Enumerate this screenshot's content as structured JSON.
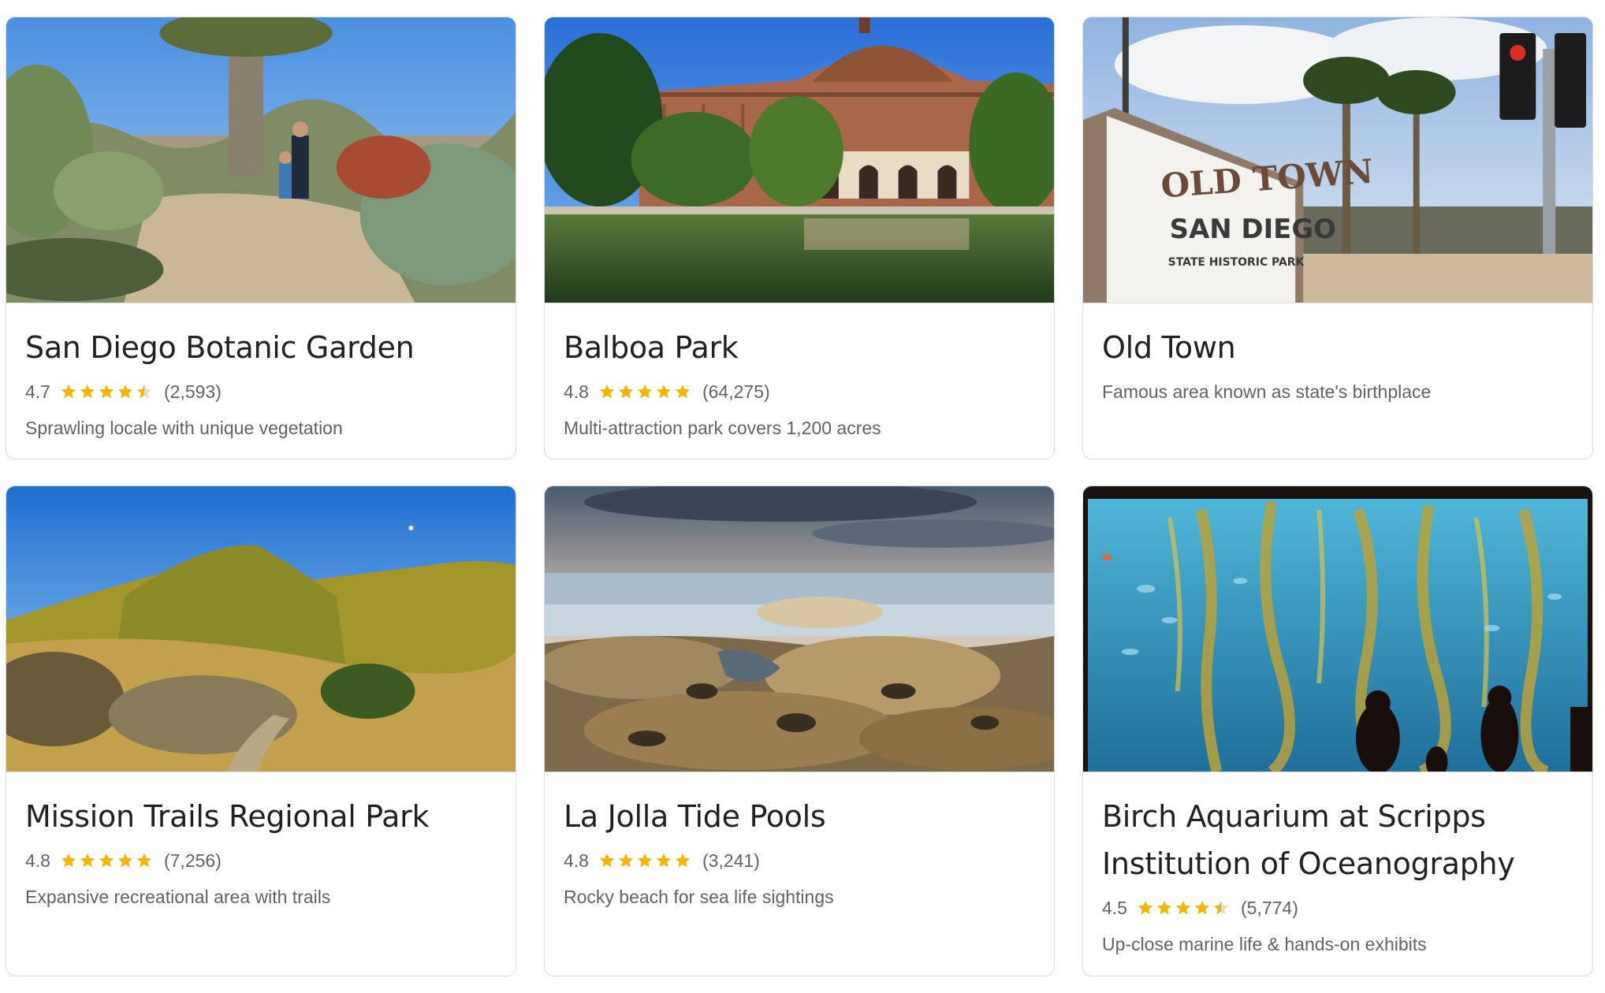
{
  "colors": {
    "star": "#f4b400",
    "star_empty": "#dadce0",
    "title": "#202124",
    "secondary": "#5f6368"
  },
  "cards": [
    {
      "title": "San Diego Botanic Garden",
      "rating": "4.7",
      "stars": 4.7,
      "reviews": "(2,593)",
      "description": "Sprawling locale with unique vegetation",
      "photo": "botanic-garden-photo"
    },
    {
      "title": "Balboa Park",
      "rating": "4.8",
      "stars": 4.8,
      "reviews": "(64,275)",
      "description": "Multi-attraction park covers 1,200 acres",
      "photo": "balboa-park-photo"
    },
    {
      "title": "Old Town",
      "description": "Famous area known as state's birthplace",
      "photo": "old-town-photo",
      "sign": {
        "line1": "OLD TOWN",
        "line2": "SAN DIEGO",
        "line3": "STATE HISTORIC PARK"
      }
    },
    {
      "title": "Mission Trails Regional Park",
      "rating": "4.8",
      "stars": 4.8,
      "reviews": "(7,256)",
      "description": "Expansive recreational area with trails",
      "photo": "mission-trails-photo"
    },
    {
      "title": "La Jolla Tide Pools",
      "rating": "4.8",
      "stars": 4.8,
      "reviews": "(3,241)",
      "description": "Rocky beach for sea life sightings",
      "photo": "tide-pools-photo"
    },
    {
      "title": "Birch Aquarium at Scripps Institution of Oceanography",
      "rating": "4.5",
      "stars": 4.5,
      "reviews": "(5,774)",
      "description": "Up-close marine life & hands-on exhibits",
      "photo": "aquarium-photo"
    }
  ]
}
